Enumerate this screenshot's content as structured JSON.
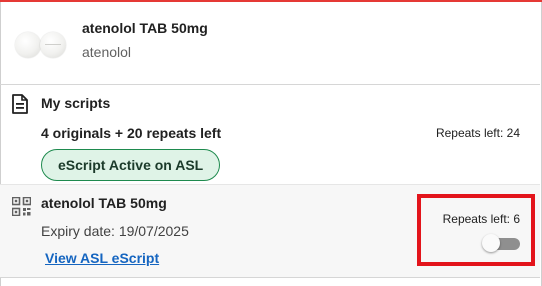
{
  "header": {
    "title": "atenolol TAB 50mg",
    "subtitle": "atenolol",
    "image_icon": "tablet-pills-image"
  },
  "my_scripts": {
    "icon": "document-icon",
    "title": "My scripts",
    "summary": "4 originals + 20 repeats left",
    "repeats_left": "Repeats left: 24",
    "badge": "eScript Active on ASL"
  },
  "script_item": {
    "icon": "qr-code-icon",
    "title": "atenolol TAB 50mg",
    "expiry": "Expiry date: 19/07/2025",
    "link": "View ASL eScript",
    "repeats_left": "Repeats left: 6",
    "toggle_on": false
  },
  "colors": {
    "accent_red": "#e3141b",
    "badge_green": "#1e8a4e",
    "badge_bg": "#dff3e7",
    "link_blue": "#1565c0"
  }
}
